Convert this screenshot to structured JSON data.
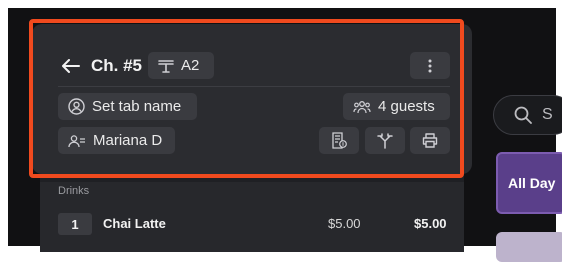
{
  "header": {
    "title": "Ch. #5",
    "table_label": "A2"
  },
  "tab": {
    "set_name_label": "Set tab name",
    "guests_label": "4 guests",
    "server_name": "Mariana D"
  },
  "order": {
    "section": "Drinks",
    "items": [
      {
        "qty": "1",
        "name": "Chai Latte",
        "price": "$5.00",
        "total": "$5.00"
      }
    ]
  },
  "search": {
    "placeholder": "S"
  },
  "categories": [
    {
      "label": "All Day"
    }
  ],
  "colors": {
    "highlight": "#f04a1e",
    "panel": "#2b2c30",
    "chip": "#3a3b40",
    "category": "#5a3f8a"
  },
  "icons": [
    "back-arrow-icon",
    "table-icon",
    "more-vertical-icon",
    "person-icon",
    "guests-icon",
    "server-icon",
    "receipt-icon",
    "split-icon",
    "print-icon",
    "search-icon"
  ]
}
